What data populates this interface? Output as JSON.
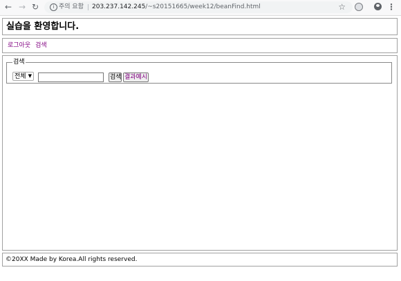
{
  "browser": {
    "back_icon": "arrow-left-icon",
    "forward_icon": "arrow-right-icon",
    "reload_icon": "reload-icon",
    "security_label": "주의 요함",
    "url_host": "203.237.142.245",
    "url_path": "/~s20151665/week12/beanFind.html",
    "bookmark_icon": "star-icon",
    "translate_icon": "globe-icon",
    "account_icon": "account-icon",
    "menu_icon": "kebab-menu-icon"
  },
  "header": {
    "title": "실습을 환영합니다."
  },
  "nav": {
    "links": [
      "로그아웃",
      "검색"
    ]
  },
  "search": {
    "legend": "검색",
    "select_value": "전체",
    "input_value": "",
    "search_button": "검색",
    "example_button": "결과예시"
  },
  "footer": {
    "text": "©20XX Made by Korea.All rights reserved."
  },
  "colors": {
    "link_visited": "#800080",
    "border": "#a0a0a0",
    "toolbar_bg": "#f8f8f9",
    "omnibox_bg": "#f1f3f4"
  }
}
